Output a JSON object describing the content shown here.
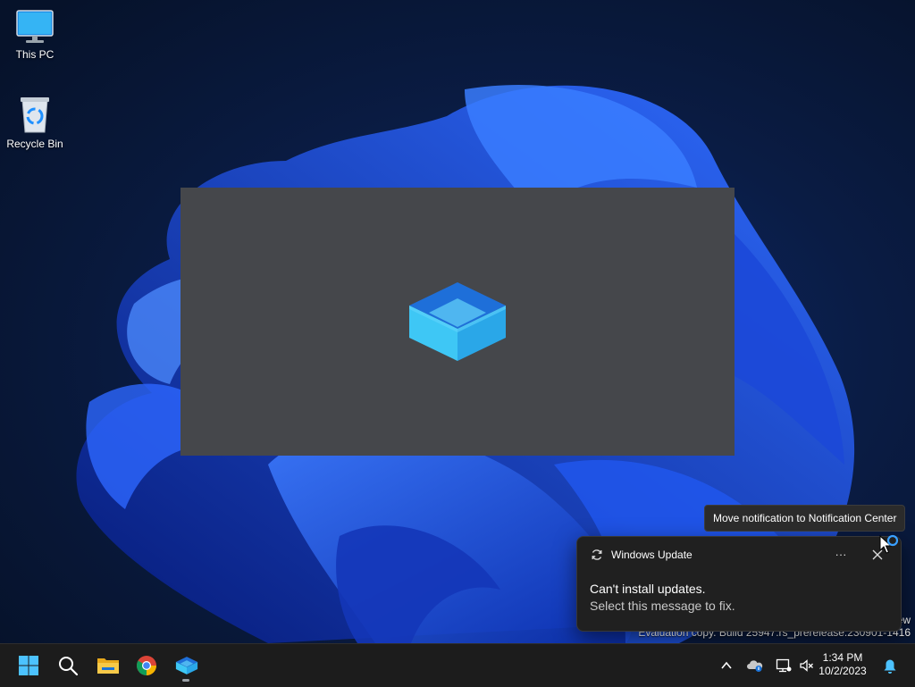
{
  "desktop": {
    "icons": [
      {
        "label": "This PC",
        "icon": "monitor-icon"
      },
      {
        "label": "Recycle Bin",
        "icon": "recycle-bin-icon"
      }
    ]
  },
  "splash": {
    "app_icon": "windows-sandbox-icon"
  },
  "watermark": {
    "edge_text": "ew",
    "build_text": "Evaluation copy. Build 25947.rs_prerelease.230901-1416"
  },
  "tooltip": {
    "text": "Move notification to Notification Center"
  },
  "notification": {
    "app_name": "Windows Update",
    "more_label": "···",
    "title": "Can't install updates.",
    "body": "Select this message to fix."
  },
  "taskbar": {
    "items": [
      "start-icon",
      "search-icon",
      "file-explorer-icon",
      "chrome-icon",
      "windows-sandbox-icon"
    ],
    "tray": [
      "chevron-up-icon",
      "onedrive-icon",
      "network-icon",
      "speaker-muted-icon",
      "bell-icon"
    ],
    "clock": {
      "time": "1:34 PM",
      "date": "10/2/2023"
    }
  },
  "colors": {
    "accent": "#0067c0",
    "toast_bg": "#202020",
    "splash_bg": "#45474b",
    "wallpaper_bloom": "#1f5cff"
  }
}
